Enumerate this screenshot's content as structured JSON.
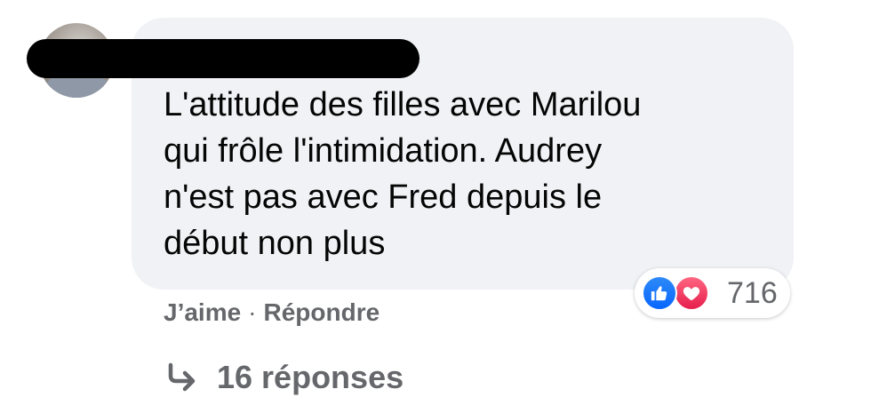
{
  "comment": {
    "author_name_redacted": true,
    "text_lines": [
      "L'attitude des filles avec Marilou",
      "qui frôle l'intimidation. Audrey",
      "n'est pas avec Fred depuis le",
      "début non plus"
    ],
    "reactions": {
      "icons": [
        "like-icon",
        "love-icon"
      ],
      "count": "716"
    },
    "actions": {
      "like_label": "J’aime",
      "separator": "·",
      "reply_label": "Répondre"
    },
    "replies": {
      "icon": "reply-arrow-icon",
      "label": "16 réponses"
    }
  },
  "colors": {
    "bubble_background": "#f0f2f5",
    "secondary_text": "#65676b",
    "like_blue": "#0866ff",
    "love_red": "#e61e4d"
  }
}
